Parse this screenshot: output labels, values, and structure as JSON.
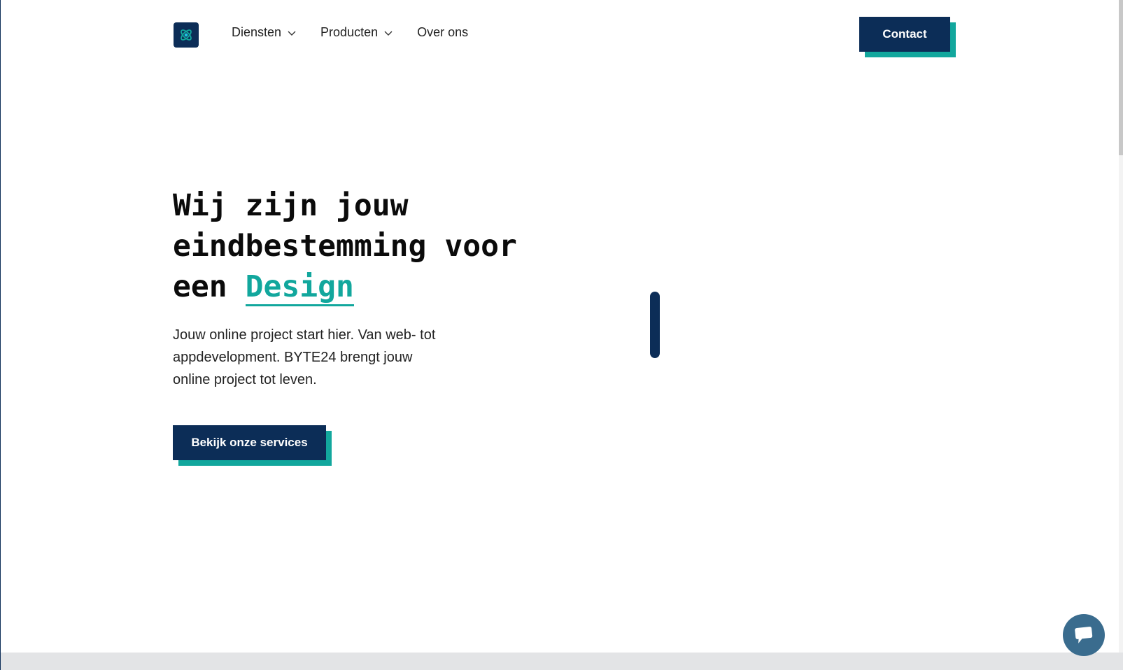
{
  "nav": {
    "items": [
      {
        "label": "Diensten",
        "has_dropdown": true
      },
      {
        "label": "Producten",
        "has_dropdown": true
      },
      {
        "label": "Over ons",
        "has_dropdown": false
      }
    ],
    "contact_label": "Contact"
  },
  "hero": {
    "title_line1": "Wij zijn jouw",
    "title_line2": "eindbestemming voor",
    "title_line3_prefix": "een ",
    "title_accent": "Design",
    "text": "Jouw online project start hier. Van web- tot appdevelopment. BYTE24 brengt jouw online project tot leven.",
    "cta_label": "Bekijk onze services"
  },
  "icons": {
    "logo": "byte24-logo-icon",
    "chevron": "chevron-down-icon",
    "chat": "chat-icon"
  },
  "colors": {
    "navy": "#0c2d57",
    "teal": "#12a79d",
    "chat": "#3a6c8e"
  }
}
